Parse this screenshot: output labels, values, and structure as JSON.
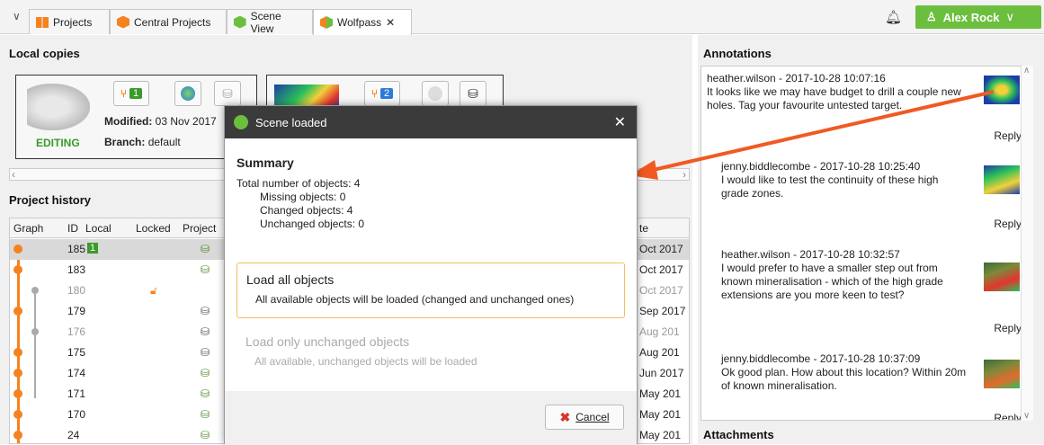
{
  "tabs": [
    {
      "label": "Projects"
    },
    {
      "label": "Central Projects"
    },
    {
      "label": "Scene View"
    },
    {
      "label": "Wolfpass",
      "close": "✕"
    }
  ],
  "user": {
    "name": "Alex Rock"
  },
  "local_copies": {
    "title": "Local copies",
    "card1": {
      "badge": "1",
      "editing": "EDITING",
      "modified_label": "Modified:",
      "modified_value": "03 Nov 2017",
      "branch_label": "Branch:",
      "branch_value": "default"
    },
    "card2": {
      "badge": "2"
    }
  },
  "history": {
    "title": "Project history",
    "columns": [
      "Graph",
      "ID",
      "Local",
      "Locked",
      "Project"
    ],
    "date_header": "te",
    "rows": [
      {
        "id": "185",
        "local": "1",
        "date": "Oct 2017"
      },
      {
        "id": "183",
        "date": "Oct 2017"
      },
      {
        "id": "180",
        "date": "Oct 2017"
      },
      {
        "id": "179",
        "date": "Sep 2017"
      },
      {
        "id": "176",
        "date": "Aug 201"
      },
      {
        "id": "175",
        "date": "Aug 201"
      },
      {
        "id": "174",
        "date": "Jun 2017"
      },
      {
        "id": "171",
        "date": "May 201"
      },
      {
        "id": "170",
        "date": "May 201"
      },
      {
        "id": "24",
        "date": "May 201"
      }
    ]
  },
  "annotations": {
    "title": "Annotations",
    "items": [
      {
        "header": "heather.wilson - 2017-10-28 10:07:16",
        "text": "It looks like we may have budget to drill a couple new holes.  Tag your favourite untested target.",
        "reply": "Reply"
      },
      {
        "header": "jenny.biddlecombe - 2017-10-28 10:25:40",
        "text": "I would like to test the continuity of these high grade zones.",
        "reply": "Reply"
      },
      {
        "header": "heather.wilson - 2017-10-28 10:32:57",
        "text": "I would prefer to have a smaller step out from known mineralisation - which of the high grade extensions are you more keen to test?",
        "reply": "Reply"
      },
      {
        "header": "jenny.biddlecombe - 2017-10-28 10:37:09",
        "text": "Ok good plan. How about this location? Within 20m of known mineralisation.",
        "reply": "Reply"
      }
    ],
    "attachments_title": "Attachments"
  },
  "dialog": {
    "title": "Scene loaded",
    "summary_title": "Summary",
    "total": "Total number of objects: 4",
    "missing": "Missing objects: 0",
    "changed": "Changed objects: 4",
    "unchanged": "Unchanged objects: 0",
    "opt1_title": "Load all objects",
    "opt1_desc": "All available objects will be loaded (changed and unchanged ones)",
    "opt2_title": "Load only unchanged objects",
    "opt2_desc": "All available, unchanged objects will be loaded",
    "cancel": "Cancel"
  },
  "colors": {
    "accent": "#f58220",
    "green": "#6cbf3e",
    "arrow": "#f05a22"
  }
}
